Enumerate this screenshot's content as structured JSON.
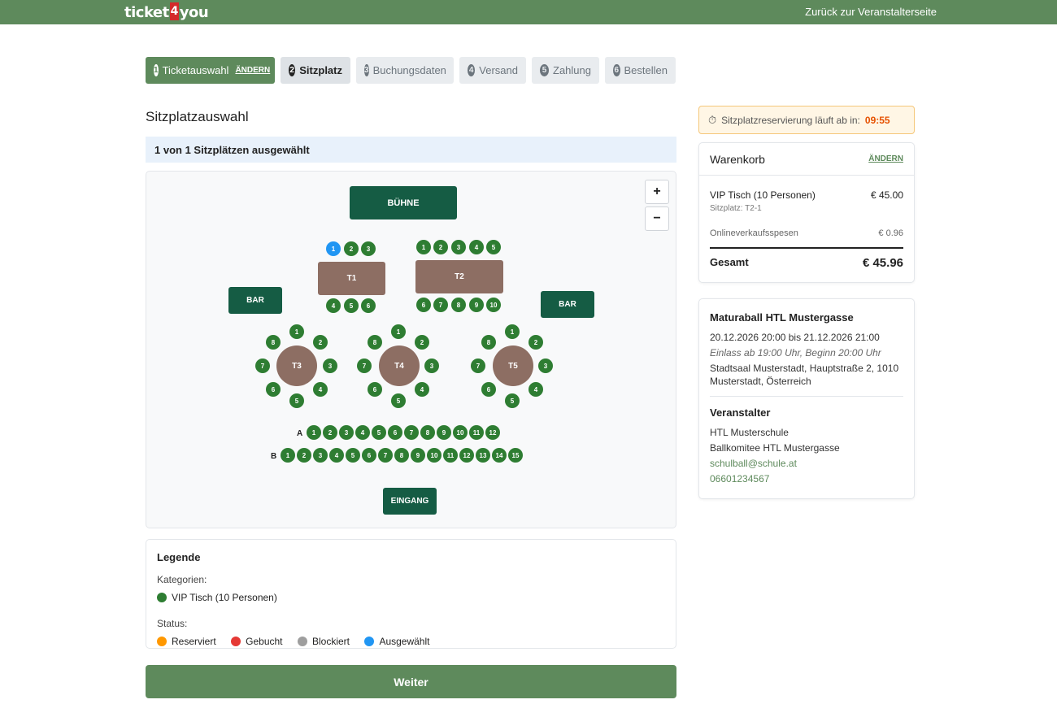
{
  "header": {
    "logo_left": "ticket",
    "logo_mid": "4",
    "logo_right": "you",
    "back_link": "Zurück zur Veranstalterseite"
  },
  "steps": [
    {
      "num": "1",
      "label": "Ticketauswahl",
      "change": "ÄNDERN",
      "state": "done"
    },
    {
      "num": "2",
      "label": "Sitzplatz",
      "state": "active"
    },
    {
      "num": "3",
      "label": "Buchungsdaten",
      "state": "todo"
    },
    {
      "num": "4",
      "label": "Versand",
      "state": "todo"
    },
    {
      "num": "5",
      "label": "Zahlung",
      "state": "todo"
    },
    {
      "num": "6",
      "label": "Bestellen",
      "state": "todo"
    }
  ],
  "main": {
    "title": "Sitzplatzauswahl",
    "selection_status": "1 von 1 Sitzplätzen ausgewählt",
    "weiter_label": "Weiter"
  },
  "map": {
    "zoom_in": "+",
    "zoom_out": "−",
    "stage": "BÜHNE",
    "bar_left": "BAR",
    "bar_right": "BAR",
    "entrance": "EINGANG",
    "tables": {
      "t1": "T1",
      "t2": "T2",
      "t3": "T3",
      "t4": "T4",
      "t5": "T5"
    },
    "rows": {
      "a": "A",
      "b": "B"
    },
    "selected_seat": "T2-1"
  },
  "legend": {
    "title": "Legende",
    "categories_label": "Kategorien:",
    "category": "VIP Tisch (10 Personen)",
    "status_label": "Status:",
    "status_reserved": "Reserviert",
    "status_booked": "Gebucht",
    "status_blocked": "Blockiert",
    "status_selected": "Ausgewählt"
  },
  "colors": {
    "brand": "#5e8a5c",
    "seat_available": "#2e7d32",
    "seat_selected": "#2196f3",
    "reserved": "#ff9800",
    "booked": "#e53935",
    "blocked": "#9e9e9e",
    "table": "#8d6e63",
    "block": "#155c44"
  },
  "timer": {
    "label": "Sitzplatzreservierung läuft ab in:",
    "time": "09:55"
  },
  "cart": {
    "title": "Warenkorb",
    "change": "ÄNDERN",
    "item_name": "VIP Tisch (10 Personen)",
    "item_price": "€ 45.00",
    "item_seat": "Sitzplatz: T2-1",
    "fee_label": "Onlineverkaufsspesen",
    "fee_value": "€ 0.96",
    "total_label": "Gesamt",
    "total_value": "€ 45.96"
  },
  "event": {
    "title": "Maturaball HTL Mustergasse",
    "date": "20.12.2026 20:00 bis 21.12.2026 21:00",
    "admission": "Einlass ab 19:00 Uhr, Beginn 20:00 Uhr",
    "venue": "Stadtsaal Musterstadt, Hauptstraße 2, 1010 Musterstadt, Österreich",
    "organizer_title": "Veranstalter",
    "organizer_line1": "HTL Musterschule",
    "organizer_line2": "Ballkomitee HTL Mustergasse",
    "email": "schulball@schule.at",
    "phone": "06601234567"
  }
}
